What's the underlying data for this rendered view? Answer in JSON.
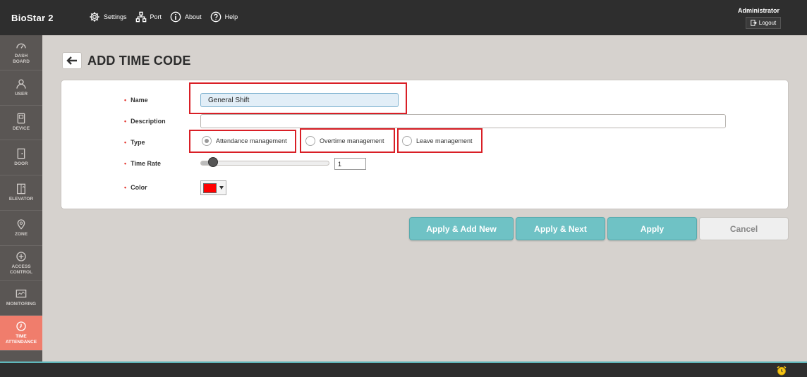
{
  "app": {
    "title": "BioStar 2"
  },
  "topnav": [
    {
      "label": "Settings",
      "icon": "gear-icon"
    },
    {
      "label": "Port",
      "icon": "network-icon"
    },
    {
      "label": "About",
      "icon": "info-icon"
    },
    {
      "label": "Help",
      "icon": "help-icon"
    }
  ],
  "user": {
    "name": "Administrator",
    "logout_label": "Logout"
  },
  "sidebar": {
    "items": [
      {
        "label": "DASH BOARD",
        "line1": "DASH",
        "line2": "BOARD",
        "icon": "dashboard-icon"
      },
      {
        "label": "USER",
        "line1": "USER",
        "line2": "",
        "icon": "user-icon"
      },
      {
        "label": "DEVICE",
        "line1": "DEVICE",
        "line2": "",
        "icon": "device-icon"
      },
      {
        "label": "DOOR",
        "line1": "DOOR",
        "line2": "",
        "icon": "door-icon"
      },
      {
        "label": "ELEVATOR",
        "line1": "ELEVATOR",
        "line2": "",
        "icon": "elevator-icon"
      },
      {
        "label": "ZONE",
        "line1": "ZONE",
        "line2": "",
        "icon": "zone-icon"
      },
      {
        "label": "ACCESS CONTROL",
        "line1": "ACCESS",
        "line2": "CONTROL",
        "icon": "access-control-icon"
      },
      {
        "label": "MONITORING",
        "line1": "MONITORING",
        "line2": "",
        "icon": "monitoring-icon"
      },
      {
        "label": "TIME ATTENDANCE",
        "line1": "TIME",
        "line2": "ATTENDANCE",
        "icon": "clock-icon",
        "active": true
      }
    ]
  },
  "page": {
    "title": "ADD TIME CODE"
  },
  "form": {
    "name": {
      "label": "Name",
      "value": "General Shift"
    },
    "description": {
      "label": "Description",
      "value": ""
    },
    "type": {
      "label": "Type",
      "options": [
        "Attendance management",
        "Overtime management",
        "Leave management"
      ],
      "selected": "Attendance management"
    },
    "time_rate": {
      "label": "Time Rate",
      "value": "1",
      "slider_fraction": 0.1
    },
    "color": {
      "label": "Color",
      "value": "#ff0000"
    }
  },
  "buttons": {
    "apply_add_new": "Apply & Add New",
    "apply_next": "Apply & Next",
    "apply": "Apply",
    "cancel": "Cancel"
  },
  "colors": {
    "topbar": "#2e2e2e",
    "sidebar": "#5a5654",
    "active_sidebar": "#f07d6c",
    "primary_button": "#6fc2c5",
    "highlight": "#d91f26"
  }
}
